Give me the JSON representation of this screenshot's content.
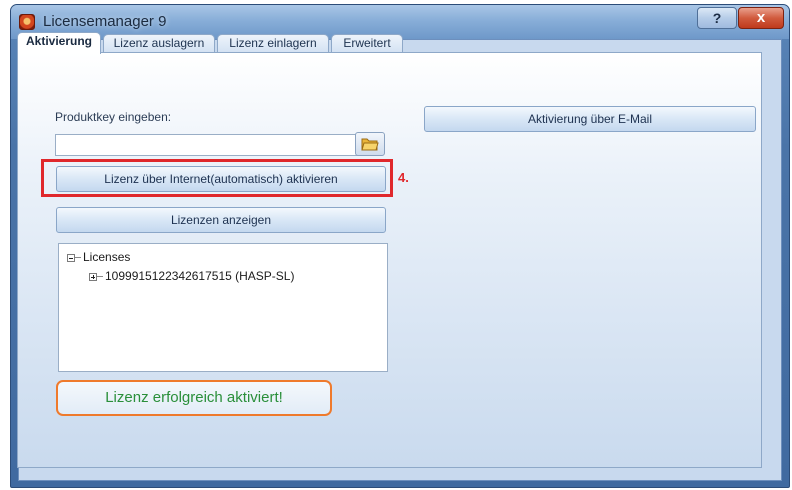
{
  "window": {
    "title": "Licensemanager 9",
    "help_label": "?",
    "close_label": "x"
  },
  "tabs": [
    {
      "label": "Aktivierung",
      "active": true
    },
    {
      "label": "Lizenz auslagern",
      "active": false
    },
    {
      "label": "Lizenz einlagern",
      "active": false
    },
    {
      "label": "Erweitert",
      "active": false
    }
  ],
  "activation": {
    "product_key_label": "Produktkey eingeben:",
    "product_key_value": "",
    "activate_internet_label": "Lizenz über Internet(automatisch) aktivieren",
    "step_marker": "4.",
    "show_licenses_label": "Lizenzen anzeigen",
    "email_activation_label": "Aktivierung über E-Mail",
    "success_message": "Lizenz erfolgreich aktiviert!"
  },
  "license_tree": {
    "root_label": "Licenses",
    "children": [
      "1099915122342617515 (HASP-SL)"
    ]
  },
  "colors": {
    "highlight_red": "#e0282c",
    "highlight_orange": "#ef7a2c",
    "success_green": "#2a8f3a",
    "panel_blue": "#c8d9ee"
  }
}
